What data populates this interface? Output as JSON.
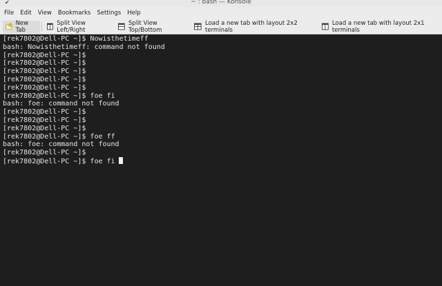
{
  "window": {
    "title": "~ : bash — Konsole"
  },
  "menu": [
    "File",
    "Edit",
    "View",
    "Bookmarks",
    "Settings",
    "Help"
  ],
  "toolbar": {
    "new_tab": "New Tab",
    "split_lr": "Split View Left/Right",
    "split_tb": "Split View Top/Bottom",
    "layout_2x2": "Load a new tab with layout 2x2 terminals",
    "layout_2x1": "Load a new tab with layout 2x1 terminals"
  },
  "terminal": {
    "lines": [
      "[rek7802@Dell-PC ~]$ Nowisthetimeff",
      "bash: Nowisthetimeff: command not found",
      "[rek7802@Dell-PC ~]$",
      "[rek7802@Dell-PC ~]$",
      "[rek7802@Dell-PC ~]$",
      "[rek7802@Dell-PC ~]$",
      "[rek7802@Dell-PC ~]$",
      "[rek7802@Dell-PC ~]$ foe fi",
      "bash: foe: command not found",
      "[rek7802@Dell-PC ~]$",
      "[rek7802@Dell-PC ~]$",
      "[rek7802@Dell-PC ~]$",
      "[rek7802@Dell-PC ~]$ foe ff",
      "bash: foe: command not found",
      "[rek7802@Dell-PC ~]$",
      "[rek7802@Dell-PC ~]$ foe fi"
    ]
  }
}
